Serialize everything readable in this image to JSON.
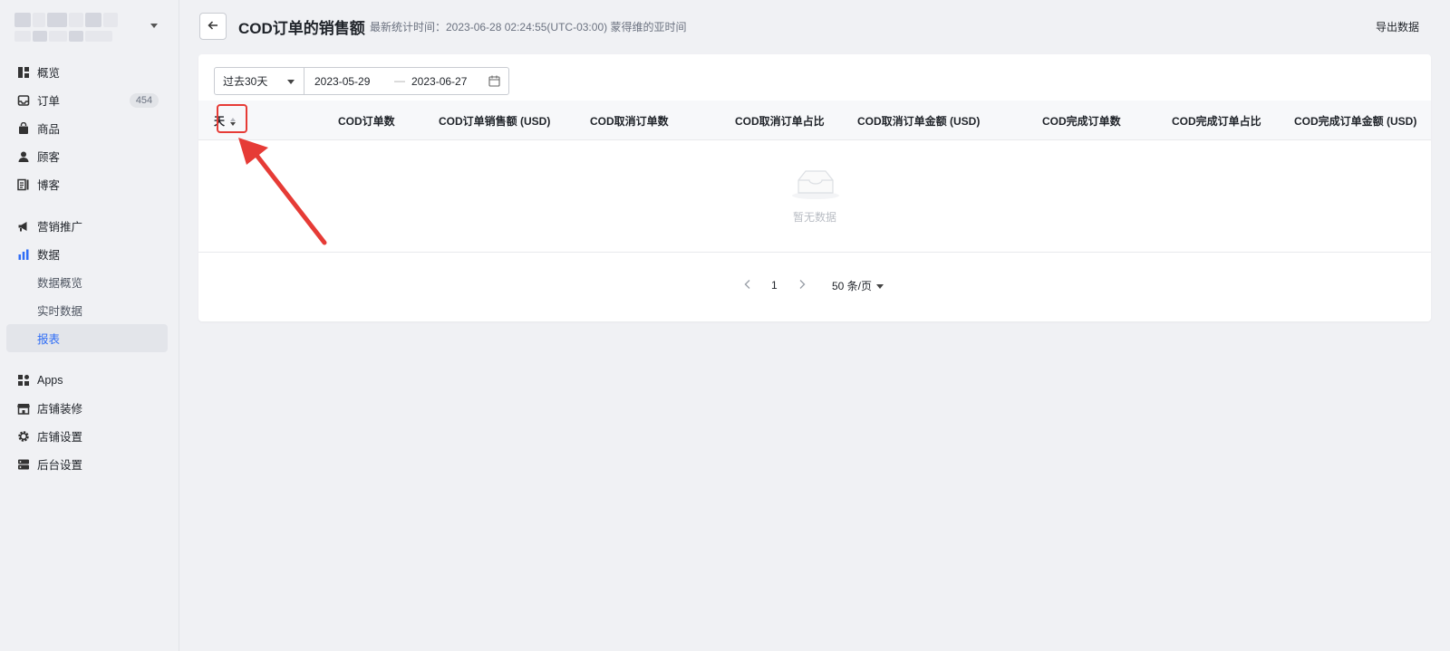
{
  "sidebar": {
    "store_name_redacted": true,
    "items": [
      {
        "key": "overview",
        "label": "概览",
        "icon": "dashboard-icon"
      },
      {
        "key": "orders",
        "label": "订单",
        "icon": "inbox-icon",
        "badge": "454"
      },
      {
        "key": "products",
        "label": "商品",
        "icon": "bag-icon"
      },
      {
        "key": "customers",
        "label": "顾客",
        "icon": "user-icon"
      },
      {
        "key": "blog",
        "label": "博客",
        "icon": "blog-icon"
      },
      {
        "key": "marketing",
        "label": "营销推广",
        "icon": "megaphone-icon"
      },
      {
        "key": "data",
        "label": "数据",
        "icon": "bar-chart-icon"
      },
      {
        "key": "data-overview",
        "label": "数据概览"
      },
      {
        "key": "realtime",
        "label": "实时数据"
      },
      {
        "key": "reports",
        "label": "报表",
        "active": true
      },
      {
        "key": "apps",
        "label": "Apps",
        "icon": "apps-icon"
      },
      {
        "key": "store-design",
        "label": "店铺装修",
        "icon": "store-icon"
      },
      {
        "key": "store-settings",
        "label": "店铺设置",
        "icon": "gear-icon"
      },
      {
        "key": "admin-settings",
        "label": "后台设置",
        "icon": "server-icon"
      }
    ]
  },
  "header": {
    "title": "COD订单的销售额",
    "stat_time": "最新统计时间：2023-06-28 02:24:55(UTC-03:00) 蒙得维的亚时间",
    "export_label": "导出数据"
  },
  "filters": {
    "range": "过去30天",
    "start_date": "2023-05-29",
    "separator": "—",
    "end_date": "2023-06-27"
  },
  "table": {
    "columns": [
      "天",
      "COD订单数",
      "COD订单销售额 (USD)",
      "COD取消订单数",
      "COD取消订单占比",
      "COD取消订单金额 (USD)",
      "COD完成订单数",
      "COD完成订单占比",
      "COD完成订单金额 (USD)"
    ],
    "empty_text": "暂无数据"
  },
  "pagination": {
    "page": "1",
    "page_size": "50 条/页"
  },
  "colors": {
    "accent": "#2f6df6",
    "annotation_red": "#e63b36"
  }
}
